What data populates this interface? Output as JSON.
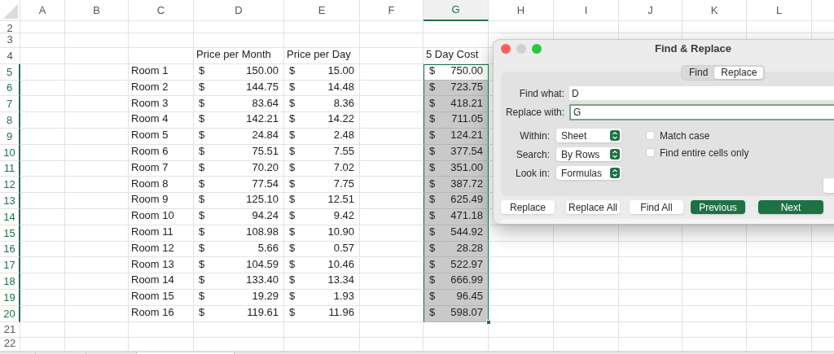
{
  "sheet": {
    "columns": [
      {
        "label": "A",
        "selected": false
      },
      {
        "label": "B",
        "selected": false
      },
      {
        "label": "C",
        "selected": false
      },
      {
        "label": "D",
        "selected": false
      },
      {
        "label": "E",
        "selected": false
      },
      {
        "label": "F",
        "selected": false
      },
      {
        "label": "G",
        "selected": true
      },
      {
        "label": "H",
        "selected": false
      },
      {
        "label": "I",
        "selected": false
      },
      {
        "label": "J",
        "selected": false
      },
      {
        "label": "K",
        "selected": false
      },
      {
        "label": "L",
        "selected": false
      }
    ],
    "rows": [
      {
        "label": "2",
        "kind": "empty",
        "selected": false
      },
      {
        "label": "3",
        "kind": "empty",
        "selected": false
      },
      {
        "label": "4",
        "kind": "header",
        "selected": false,
        "month": "Price per Month",
        "day": "Price per Day",
        "cost": "5 Day Cost"
      },
      {
        "label": "5",
        "kind": "data",
        "selected": true,
        "active": true,
        "room": "Room 1",
        "month": {
          "symbol": "$",
          "amount": "150.00"
        },
        "day": {
          "symbol": "$",
          "amount": "15.00"
        },
        "cost": {
          "symbol": "$",
          "amount": "750.00"
        }
      },
      {
        "label": "6",
        "kind": "data",
        "selected": true,
        "active": false,
        "room": "Room 2",
        "month": {
          "symbol": "$",
          "amount": "144.75"
        },
        "day": {
          "symbol": "$",
          "amount": "14.48"
        },
        "cost": {
          "symbol": "$",
          "amount": "723.75"
        }
      },
      {
        "label": "7",
        "kind": "data",
        "selected": true,
        "active": false,
        "room": "Room 3",
        "month": {
          "symbol": "$",
          "amount": "83.64"
        },
        "day": {
          "symbol": "$",
          "amount": "8.36"
        },
        "cost": {
          "symbol": "$",
          "amount": "418.21"
        }
      },
      {
        "label": "8",
        "kind": "data",
        "selected": true,
        "active": false,
        "room": "Room 4",
        "month": {
          "symbol": "$",
          "amount": "142.21"
        },
        "day": {
          "symbol": "$",
          "amount": "14.22"
        },
        "cost": {
          "symbol": "$",
          "amount": "711.05"
        }
      },
      {
        "label": "9",
        "kind": "data",
        "selected": true,
        "active": false,
        "room": "Room 5",
        "month": {
          "symbol": "$",
          "amount": "24.84"
        },
        "day": {
          "symbol": "$",
          "amount": "2.48"
        },
        "cost": {
          "symbol": "$",
          "amount": "124.21"
        }
      },
      {
        "label": "10",
        "kind": "data",
        "selected": true,
        "active": false,
        "room": "Room 6",
        "month": {
          "symbol": "$",
          "amount": "75.51"
        },
        "day": {
          "symbol": "$",
          "amount": "7.55"
        },
        "cost": {
          "symbol": "$",
          "amount": "377.54"
        }
      },
      {
        "label": "11",
        "kind": "data",
        "selected": true,
        "active": false,
        "room": "Room 7",
        "month": {
          "symbol": "$",
          "amount": "70.20"
        },
        "day": {
          "symbol": "$",
          "amount": "7.02"
        },
        "cost": {
          "symbol": "$",
          "amount": "351.00"
        }
      },
      {
        "label": "12",
        "kind": "data",
        "selected": true,
        "active": false,
        "room": "Room 8",
        "month": {
          "symbol": "$",
          "amount": "77.54"
        },
        "day": {
          "symbol": "$",
          "amount": "7.75"
        },
        "cost": {
          "symbol": "$",
          "amount": "387.72"
        }
      },
      {
        "label": "13",
        "kind": "data",
        "selected": true,
        "active": false,
        "room": "Room 9",
        "month": {
          "symbol": "$",
          "amount": "125.10"
        },
        "day": {
          "symbol": "$",
          "amount": "12.51"
        },
        "cost": {
          "symbol": "$",
          "amount": "625.49"
        }
      },
      {
        "label": "14",
        "kind": "data",
        "selected": true,
        "active": false,
        "room": "Room 10",
        "month": {
          "symbol": "$",
          "amount": "94.24"
        },
        "day": {
          "symbol": "$",
          "amount": "9.42"
        },
        "cost": {
          "symbol": "$",
          "amount": "471.18"
        }
      },
      {
        "label": "15",
        "kind": "data",
        "selected": true,
        "active": false,
        "room": "Room 11",
        "month": {
          "symbol": "$",
          "amount": "108.98"
        },
        "day": {
          "symbol": "$",
          "amount": "10.90"
        },
        "cost": {
          "symbol": "$",
          "amount": "544.92"
        }
      },
      {
        "label": "16",
        "kind": "data",
        "selected": true,
        "active": false,
        "room": "Room 12",
        "month": {
          "symbol": "$",
          "amount": "5.66"
        },
        "day": {
          "symbol": "$",
          "amount": "0.57"
        },
        "cost": {
          "symbol": "$",
          "amount": "28.28"
        }
      },
      {
        "label": "17",
        "kind": "data",
        "selected": true,
        "active": false,
        "room": "Room 13",
        "month": {
          "symbol": "$",
          "amount": "104.59"
        },
        "day": {
          "symbol": "$",
          "amount": "10.46"
        },
        "cost": {
          "symbol": "$",
          "amount": "522.97"
        }
      },
      {
        "label": "18",
        "kind": "data",
        "selected": true,
        "active": false,
        "room": "Room 14",
        "month": {
          "symbol": "$",
          "amount": "133.40"
        },
        "day": {
          "symbol": "$",
          "amount": "13.34"
        },
        "cost": {
          "symbol": "$",
          "amount": "666.99"
        }
      },
      {
        "label": "19",
        "kind": "data",
        "selected": true,
        "active": false,
        "room": "Room 15",
        "month": {
          "symbol": "$",
          "amount": "19.29"
        },
        "day": {
          "symbol": "$",
          "amount": "1.93"
        },
        "cost": {
          "symbol": "$",
          "amount": "96.45"
        }
      },
      {
        "label": "20",
        "kind": "data",
        "selected": true,
        "active": false,
        "room": "Room 16",
        "month": {
          "symbol": "$",
          "amount": "119.61"
        },
        "day": {
          "symbol": "$",
          "amount": "11.96"
        },
        "cost": {
          "symbol": "$",
          "amount": "598.07"
        }
      },
      {
        "label": "21",
        "kind": "empty",
        "selected": false
      },
      {
        "label": "22",
        "kind": "empty",
        "selected": false
      }
    ]
  },
  "dialog": {
    "title": "Find & Replace",
    "tabs": [
      {
        "label": "Find",
        "selected": false
      },
      {
        "label": "Replace",
        "selected": true
      }
    ],
    "fields": [
      {
        "label": "Find what:",
        "value": "D",
        "focused": false
      },
      {
        "label": "Replace with:",
        "value": "G",
        "focused": true
      }
    ],
    "selects": [
      {
        "label": "Within:",
        "value": "Sheet"
      },
      {
        "label": "Search:",
        "value": "By Rows"
      },
      {
        "label": "Look in:",
        "value": "Formulas"
      }
    ],
    "checkboxes": [
      {
        "label": "Match case",
        "checked": false
      },
      {
        "label": "Find entire cells only",
        "checked": false
      }
    ],
    "buttons": [
      {
        "label": "Replace",
        "kind": "default"
      },
      {
        "label": "Replace All",
        "kind": "default"
      },
      {
        "label": "Find All",
        "kind": "default"
      },
      {
        "label": "Previous",
        "kind": "primary"
      },
      {
        "label": "Next",
        "kind": "primary"
      }
    ]
  }
}
